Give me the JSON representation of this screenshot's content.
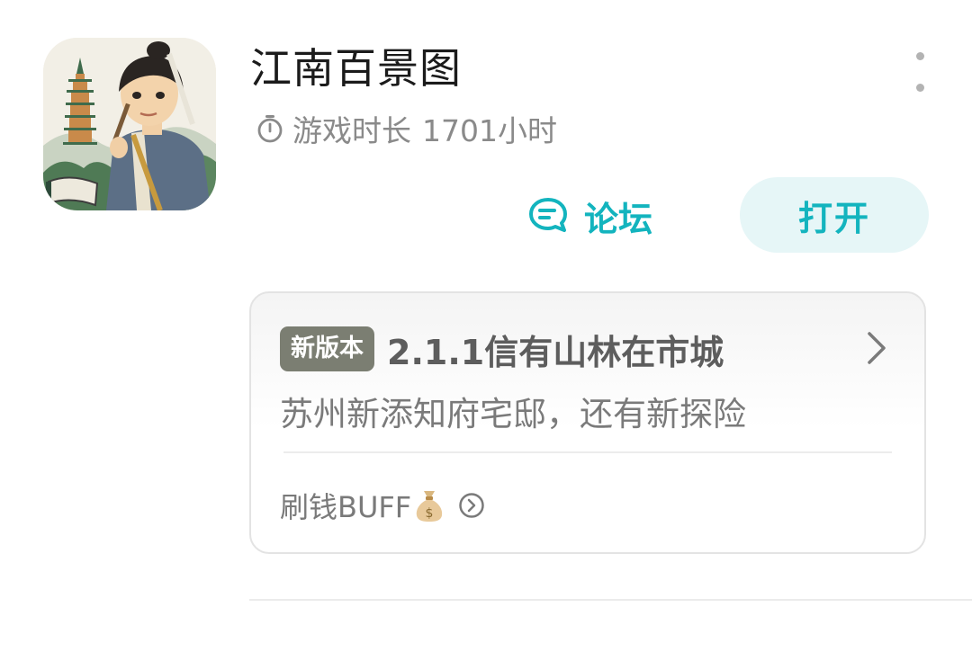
{
  "app": {
    "icon": "app-icon-artwork",
    "title": "江南百景图",
    "playtime_label": "游戏时长",
    "playtime_value": "1701小时"
  },
  "actions": {
    "forum_label": "论坛",
    "open_label": "打开"
  },
  "update_card": {
    "badge": "新版本",
    "version_title": "2.1.1信有山林在市城",
    "description": "苏州新添知府宅邸，还有新探险",
    "buff_text": "刷钱BUFF"
  },
  "colors": {
    "accent": "#13b4be",
    "open_button_bg": "#e6f6f7",
    "badge_bg": "#7b7e72"
  },
  "icons": [
    "more-vertical-icon",
    "timer-icon",
    "forum-chat-icon",
    "chevron-right-icon",
    "moneybag-icon",
    "arrow-circle-right-icon"
  ]
}
